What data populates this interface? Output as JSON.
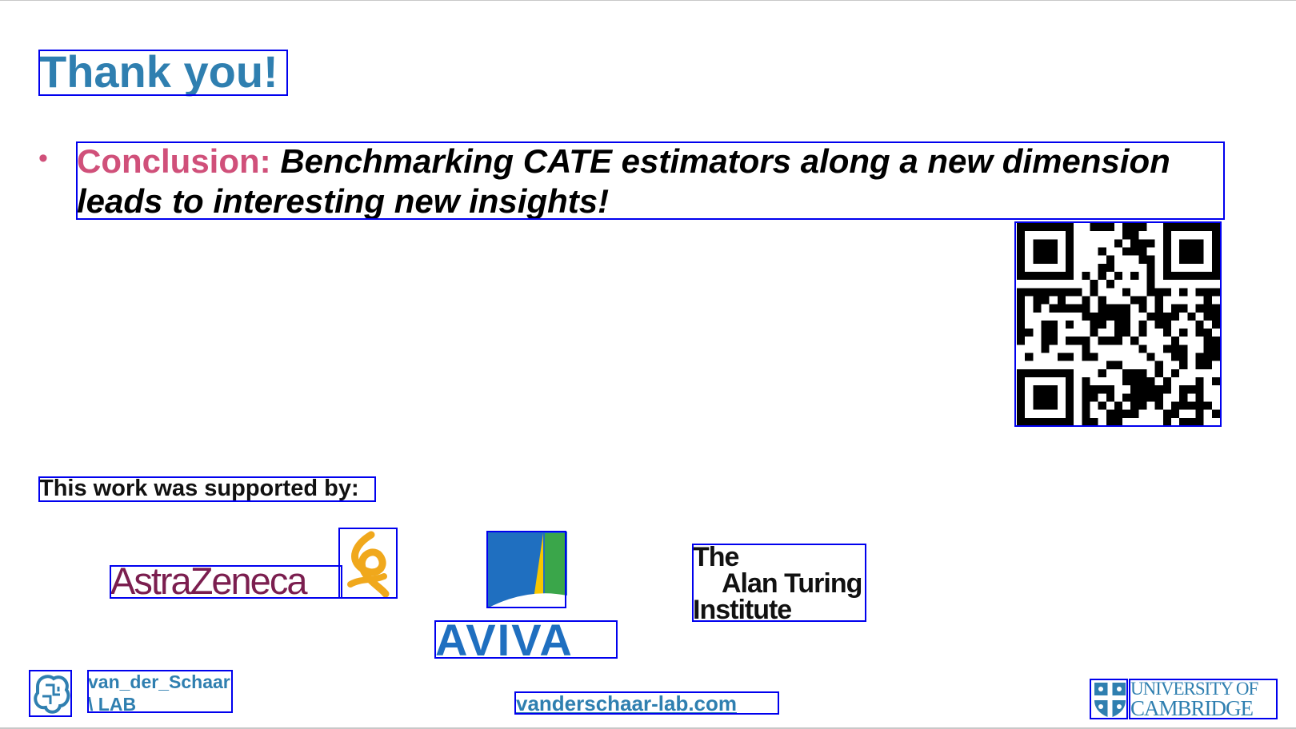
{
  "slide": {
    "title": "Thank you!",
    "bullet": {
      "label": "Conclusion:",
      "text": "Benchmarking CATE estimators along a new dimension leads to interesting new insights!"
    },
    "qr_code": {
      "icon": "qr-code-icon"
    },
    "supported_by_label": "This work was supported by:",
    "sponsors": {
      "astrazeneca": {
        "name": "AstraZeneca",
        "color": "#7b1e4f",
        "mark_color": "#f0a81c"
      },
      "aviva": {
        "name": "AVIVA",
        "color": "#1f6fc0"
      },
      "turing": {
        "line1": "The",
        "line2": "Alan Turing",
        "line3": "Institute"
      }
    },
    "footer": {
      "lab_line1": "van_der_Schaar",
      "lab_line2": "\\ LAB",
      "url": "vanderschaar-lab.com",
      "cambridge_line1": "UNIVERSITY OF",
      "cambridge_line2": "CAMBRIDGE"
    }
  },
  "colors": {
    "accent_blue": "#2f7fb0",
    "conclusion_pink": "#d0507a"
  }
}
